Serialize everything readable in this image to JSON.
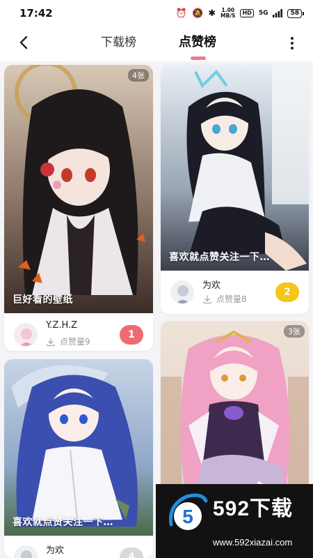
{
  "status_bar": {
    "time": "17:42",
    "speed_value": "1.00",
    "speed_unit": "MB/S",
    "hd": "HD",
    "network": "5G",
    "battery": "58",
    "icons": [
      "alarm-icon",
      "mute-icon",
      "bluetooth-icon",
      "signal-icon"
    ]
  },
  "header": {
    "tabs": [
      {
        "label": "下载榜",
        "active": false
      },
      {
        "label": "点赞榜",
        "active": true
      }
    ],
    "accent": "#f07a92"
  },
  "cards": [
    {
      "count": "4张",
      "caption": "巨好看的壁纸",
      "author": "Y.Z.H.Z",
      "likes_label": "点赞量9",
      "rank": "1",
      "rank_color": "#ef6b73"
    },
    {
      "count": "",
      "caption": "喜欢就点赞关注一下…",
      "author": "为欢",
      "likes_label": "点赞量8",
      "rank": "2",
      "rank_color": "#f5c518"
    },
    {
      "count": "3张",
      "caption": "",
      "author": "",
      "likes_label": "",
      "rank": "",
      "rank_color": "#cccccc"
    },
    {
      "count": "",
      "caption": "喜欢就点赞关注一下…",
      "author": "为欢",
      "likes_label": "",
      "rank": "4",
      "rank_color": "#d9d9d9"
    }
  ],
  "watermark": {
    "logo_char": "5",
    "title": "592下载",
    "url": "www.592xiazai.com"
  }
}
